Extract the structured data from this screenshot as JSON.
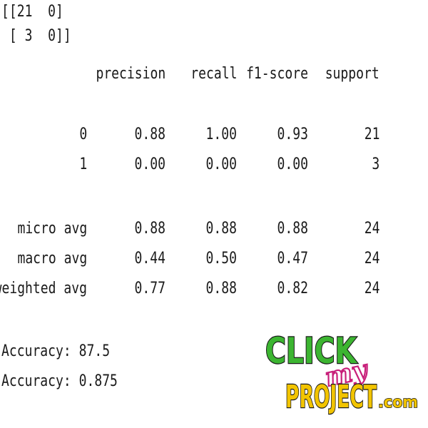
{
  "confusion_matrix": {
    "line1": "[[21  0]",
    "line2": " [ 3  0]]"
  },
  "report": {
    "headers": [
      "precision",
      "recall",
      "f1-score",
      "support"
    ],
    "rows": [
      {
        "label": "0",
        "precision": "0.88",
        "recall": "1.00",
        "f1": "0.93",
        "support": "21"
      },
      {
        "label": "1",
        "precision": "0.00",
        "recall": "0.00",
        "f1": "0.00",
        "support": "3"
      },
      {
        "label": "micro avg",
        "precision": "0.88",
        "recall": "0.88",
        "f1": "0.88",
        "support": "24"
      },
      {
        "label": "macro avg",
        "precision": "0.44",
        "recall": "0.50",
        "f1": "0.47",
        "support": "24"
      },
      {
        "label": "weighted avg",
        "precision": "0.77",
        "recall": "0.88",
        "f1": "0.82",
        "support": "24"
      }
    ]
  },
  "accuracy": {
    "line1": "Accuracy: 87.5",
    "line2": "Accuracy: 0.875"
  },
  "logo": {
    "word1": "CLICK",
    "word2": "my",
    "word3": "PROJECT",
    "suffix": ".com",
    "colors": {
      "green": "#3cb531",
      "yellow": "#f2c400",
      "magenta": "#c8207a",
      "outline": "#1a1a1a"
    }
  }
}
